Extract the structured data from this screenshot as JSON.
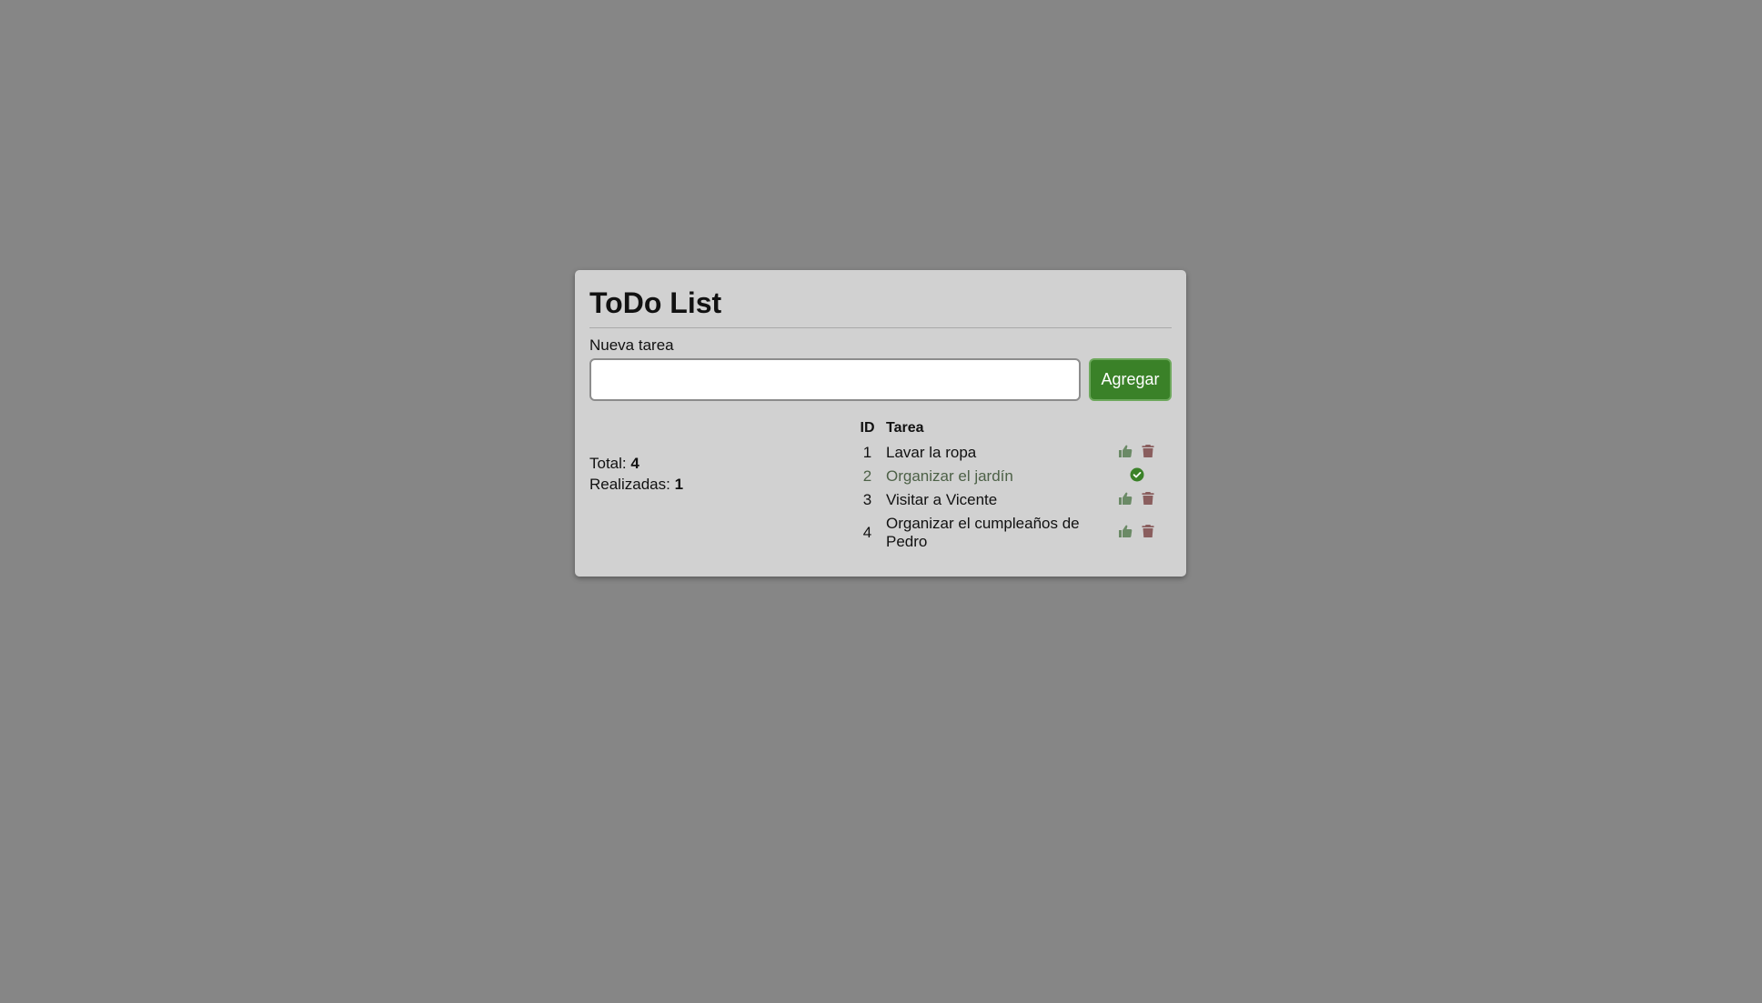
{
  "app": {
    "title": "ToDo List"
  },
  "form": {
    "label": "Nueva tarea",
    "value": "",
    "add_label": "Agregar"
  },
  "stats": {
    "total_label": "Total:",
    "total_value": "4",
    "done_label": "Realizadas:",
    "done_value": "1"
  },
  "table": {
    "headers": {
      "id": "ID",
      "task": "Tarea"
    },
    "rows": [
      {
        "id": "1",
        "task": "Lavar la ropa",
        "done": false
      },
      {
        "id": "2",
        "task": "Organizar el jardín",
        "done": true
      },
      {
        "id": "3",
        "task": "Visitar a Vicente",
        "done": false
      },
      {
        "id": "4",
        "task": "Organizar el cumpleaños de Pedro",
        "done": false
      }
    ]
  },
  "icons": {
    "complete": "thumbs-up-icon",
    "delete": "trash-icon",
    "done": "check-circle-icon"
  },
  "colors": {
    "background": "#868686",
    "card": "#d1d1d1",
    "accent": "#3a8128",
    "thumb": "#6b8a66",
    "trash": "#8a5e5e",
    "done_text": "#4d6147"
  }
}
